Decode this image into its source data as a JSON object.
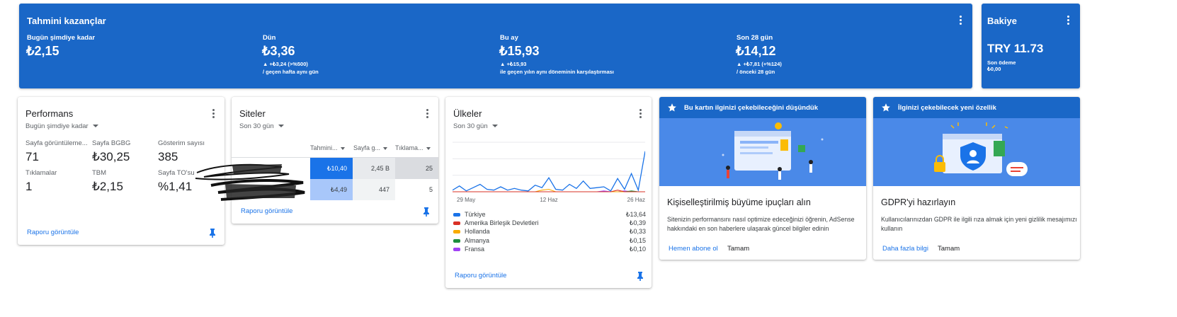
{
  "earnings": {
    "title": "Tahmini kazançlar",
    "today": {
      "label": "Bugün şimdiye kadar",
      "value": "₺2,15"
    },
    "yesterday": {
      "label": "Dün",
      "value": "₺3,36",
      "delta": "▲ +₺3,24 (>%500)",
      "compare": "/ geçen hafta aynı gün"
    },
    "month": {
      "label": "Bu ay",
      "value": "₺15,93",
      "delta": "▲ +₺15,93",
      "compare": "ile geçen yılın aynı döneminin karşılaştırması"
    },
    "last28": {
      "label": "Son 28 gün",
      "value": "₺14,12",
      "delta": "▲ +₺7,81 (+%124)",
      "compare": "/ önceki 28 gün"
    }
  },
  "balance": {
    "title": "Bakiye",
    "value": "TRY 11.73",
    "last_payment_label": "Son ödeme",
    "last_payment_value": "₺0,00"
  },
  "performance": {
    "title": "Performans",
    "range": "Bugün şimdiye kadar",
    "metrics": [
      {
        "label": "Sayfa görüntüleme...",
        "value": "71"
      },
      {
        "label": "Sayfa BGBG",
        "value": "₺30,25"
      },
      {
        "label": "Gösterim sayısı",
        "value": "385"
      },
      {
        "label": "Tıklamalar",
        "value": "1"
      },
      {
        "label": "TBM",
        "value": "₺2,15"
      },
      {
        "label": "Sayfa TO'su",
        "value": "%1,41"
      }
    ],
    "report_link": "Raporu görüntüle"
  },
  "sites": {
    "title": "Siteler",
    "range": "Son 30 gün",
    "columns": [
      "Tahmini...",
      "Sayfa g...",
      "Tıklama..."
    ],
    "rows": [
      {
        "earnings": "₺10,40",
        "pageviews": "2,45 B",
        "clicks": "25"
      },
      {
        "earnings": "₺4,49",
        "pageviews": "447",
        "clicks": "5"
      }
    ],
    "report_link": "Raporu görüntüle"
  },
  "countries": {
    "title": "Ülkeler",
    "range": "Son 30 gün",
    "x_ticks": [
      "29 May",
      "12 Haz",
      "26 Haz"
    ],
    "legend": [
      {
        "name": "Türkiye",
        "value": "₺13,64",
        "color": "#1a73e8"
      },
      {
        "name": "Amerika Birleşik Devletleri",
        "value": "₺0,39",
        "color": "#d93025"
      },
      {
        "name": "Hollanda",
        "value": "₺0,33",
        "color": "#f9ab00"
      },
      {
        "name": "Almanya",
        "value": "₺0,15",
        "color": "#1e8e3e"
      },
      {
        "name": "Fransa",
        "value": "₺0,10",
        "color": "#a142f4"
      }
    ],
    "report_link": "Raporu görüntüle"
  },
  "chart_data": {
    "type": "line",
    "x": [
      "29 May",
      "",
      "",
      "",
      "",
      "",
      "",
      "",
      "",
      "",
      "",
      "",
      "",
      "",
      "12 Haz",
      "",
      "",
      "",
      "",
      "",
      "",
      "",
      "",
      "",
      "",
      "",
      "",
      "",
      "26 Haz"
    ],
    "series": [
      {
        "name": "Türkiye",
        "values": [
          0.2,
          0.7,
          0.1,
          0.5,
          0.9,
          0.3,
          0.2,
          0.6,
          0.2,
          0.4,
          0.2,
          0.1,
          0.8,
          0.5,
          1.7,
          0.3,
          0.2,
          0.9,
          0.4,
          1.3,
          0.4,
          0.5,
          0.6,
          0.1,
          1.6,
          0.3,
          2.2,
          0.2,
          4.9
        ]
      },
      {
        "name": "Amerika Birleşik Devletleri",
        "values": [
          0,
          0,
          0,
          0,
          0,
          0,
          0,
          0,
          0,
          0,
          0,
          0,
          0,
          0,
          0,
          0,
          0,
          0,
          0,
          0,
          0,
          0,
          0,
          0,
          0.2,
          0,
          0,
          0,
          0
        ]
      },
      {
        "name": "Hollanda",
        "values": [
          0,
          0,
          0,
          0,
          0,
          0,
          0,
          0,
          0,
          0,
          0,
          0,
          0,
          0.2,
          0.3,
          0,
          0,
          0,
          0,
          0,
          0,
          0,
          0,
          0,
          0,
          0,
          0,
          0,
          0
        ]
      },
      {
        "name": "Almanya",
        "values": [
          0,
          0,
          0,
          0,
          0,
          0,
          0,
          0,
          0,
          0,
          0,
          0,
          0,
          0,
          0,
          0,
          0,
          0,
          0,
          0,
          0,
          0,
          0,
          0,
          0,
          0,
          0.1,
          0,
          0
        ]
      },
      {
        "name": "Fransa",
        "values": [
          0,
          0,
          0,
          0,
          0,
          0,
          0,
          0,
          0,
          0,
          0,
          0,
          0,
          0,
          0,
          0,
          0,
          0,
          0,
          0,
          0,
          0,
          0.1,
          0,
          0,
          0.1,
          0,
          0,
          0
        ]
      }
    ],
    "ylim": [
      0,
      6
    ],
    "grid": true
  },
  "promo1": {
    "header": "Bu kartın ilginizi çekebileceğini düşündük",
    "title": "Kişiselleştirilmiş büyüme ipuçları alın",
    "desc": "Sitenizin performansını nasıl optimize edeceğinizi öğrenin, AdSense hakkındaki en son haberlere ulaşarak güncel bilgiler edinin",
    "action": "Hemen abone ol",
    "dismiss": "Tamam"
  },
  "promo2": {
    "header": "İlginizi çekebilecek yeni özellik",
    "title": "GDPR'yi hazırlayın",
    "desc": "Kullanıcılarınızdan GDPR ile ilgili rıza almak için yeni gizlilik mesajımızı kullanın",
    "action": "Daha fazla bilgi",
    "dismiss": "Tamam"
  },
  "colors": {
    "brand_blue": "#1a67c7",
    "link_blue": "#1a73e8",
    "cell_dark": "#1a73e8",
    "cell_light": "#a8c7fa"
  }
}
